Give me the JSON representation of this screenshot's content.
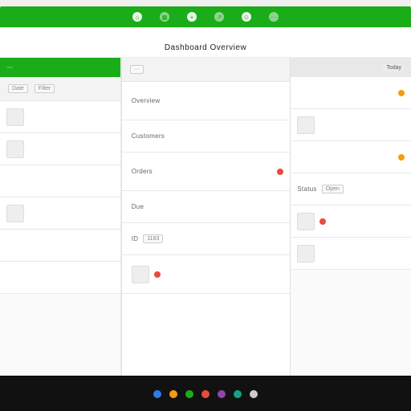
{
  "topbar": {
    "icons": [
      "home",
      "apps",
      "new",
      "share",
      "user",
      "more"
    ]
  },
  "header": {
    "title": "Dashboard Overview"
  },
  "toolbar": {
    "date_label": "Date",
    "filter_label": "Filter"
  },
  "left": {
    "head_label": "",
    "rows": [
      {
        "label": ""
      },
      {
        "label": ""
      },
      {
        "label": ""
      },
      {
        "label": ""
      },
      {
        "label": ""
      },
      {
        "label": ""
      }
    ]
  },
  "center": {
    "rows": [
      {
        "label": "Overview",
        "value": ""
      },
      {
        "label": "Customers",
        "value": ""
      },
      {
        "label": "Orders",
        "value": "",
        "status": "red"
      },
      {
        "label": "Due",
        "value": ""
      },
      {
        "label": "ID",
        "value": "1183"
      },
      {
        "label": "",
        "value": "",
        "status": "red"
      }
    ]
  },
  "right": {
    "head_label": "Today",
    "rows": [
      {
        "label": "",
        "status": "yellow"
      },
      {
        "label": ""
      },
      {
        "label": "",
        "status": "yellow"
      },
      {
        "label": "Status",
        "badge": "Open"
      },
      {
        "label": "",
        "status": "red"
      },
      {
        "label": ""
      }
    ]
  },
  "taskbar": {
    "colors": [
      "#2b7de9",
      "#f39c12",
      "#1aad19",
      "#e74c3c",
      "#8e44ad",
      "#16a085",
      "#ccc"
    ]
  }
}
